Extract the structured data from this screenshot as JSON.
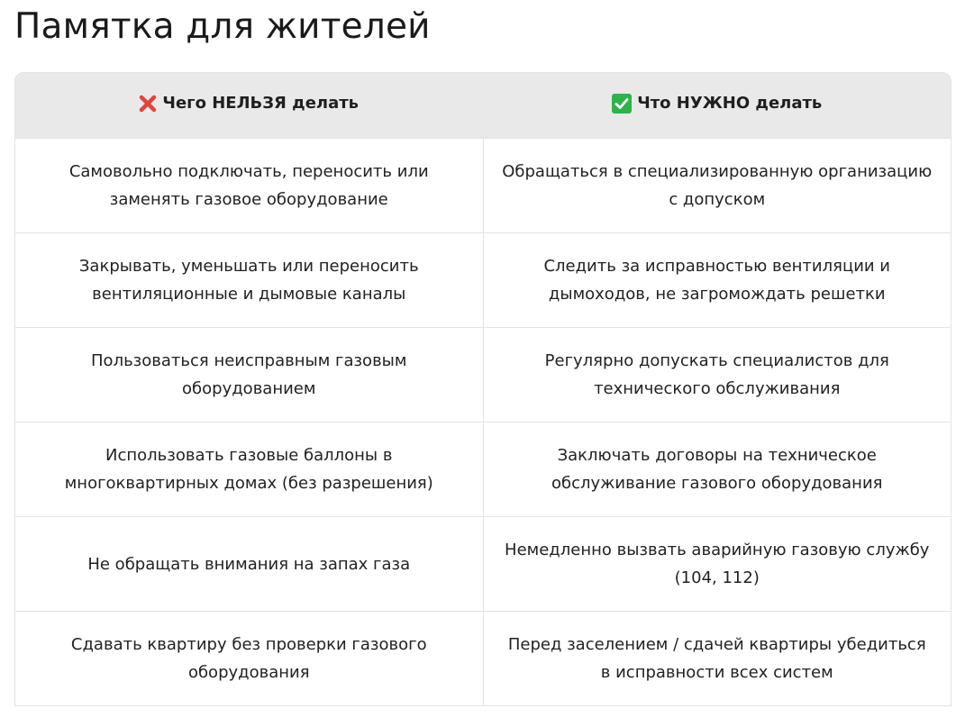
{
  "page": {
    "title": "Памятка для жителей"
  },
  "table": {
    "headers": [
      {
        "icon": "cross-mark-icon",
        "label": "Чего НЕЛЬЗЯ делать",
        "color": "#e0453f"
      },
      {
        "icon": "check-mark-icon",
        "label": "Что НУЖНО делать",
        "color": "#2db34a"
      }
    ],
    "rows": [
      {
        "dont": "Самовольно подключать, переносить или заменять газовое оборудование",
        "do": "Обращаться в специализированную организацию с допуском"
      },
      {
        "dont": "Закрывать, уменьшать или переносить вентиляционные и дымовые каналы",
        "do": "Следить за исправностью вентиляции и дымоходов, не загромождать решетки"
      },
      {
        "dont": "Пользоваться неисправным газовым оборудованием",
        "do": "Регулярно допускать специалистов для технического обслуживания"
      },
      {
        "dont": "Использовать газовые баллоны в многоквартирных домах (без разрешения)",
        "do": "Заключать договоры на техническое обслуживание газового оборудования"
      },
      {
        "dont": "Не обращать внимания на запах газа",
        "do": "Немедленно вызвать аварийную газовую службу (104, 112)"
      },
      {
        "dont": "Сдавать квартиру без проверки газового оборудования",
        "do": "Перед заселением / сдачей квартиры убедиться в исправности всех систем"
      }
    ]
  }
}
